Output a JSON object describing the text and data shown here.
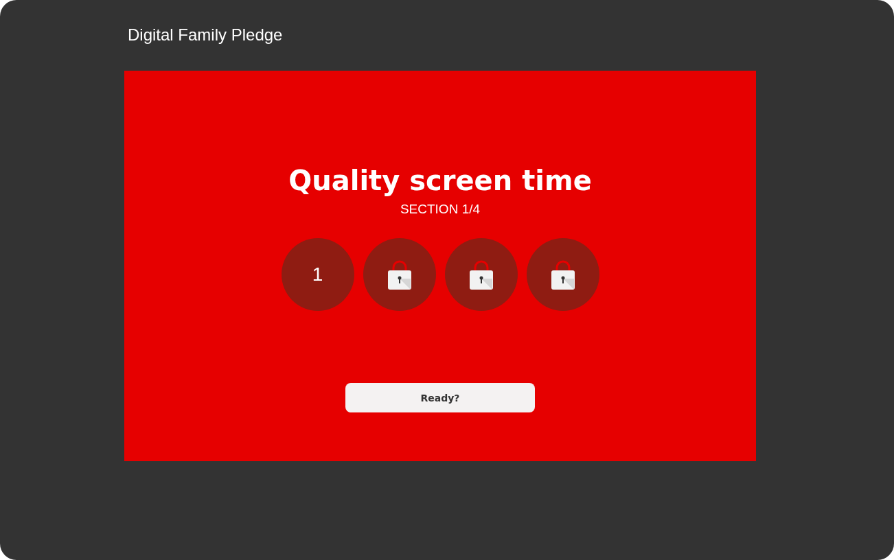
{
  "app_title": "Digital Family Pledge",
  "heading": "Quality screen time",
  "section_label": "SECTION 1/4",
  "sections": [
    {
      "kind": "number",
      "label": "1"
    },
    {
      "kind": "locked"
    },
    {
      "kind": "locked"
    },
    {
      "kind": "locked"
    }
  ],
  "button": "Ready?"
}
